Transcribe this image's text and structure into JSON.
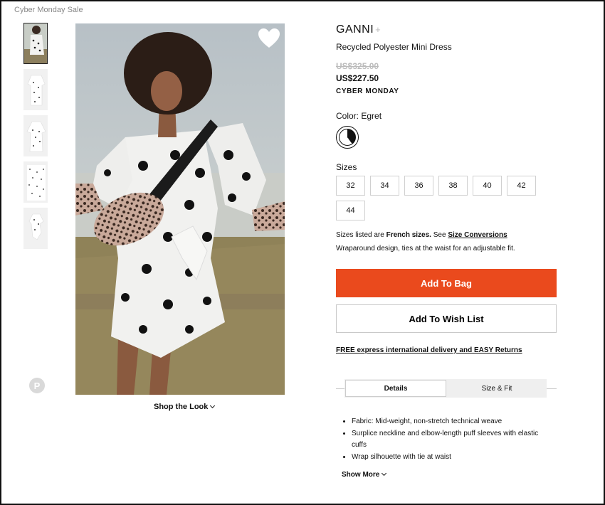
{
  "breadcrumb": "Cyber Monday Sale",
  "thumbnails": [
    "thumb-1",
    "thumb-2",
    "thumb-3",
    "thumb-4",
    "thumb-5"
  ],
  "pinterest_glyph": "P",
  "shop_the_look": "Shop the Look",
  "product": {
    "brand": "GANNI",
    "brand_plus": "+",
    "name": "Recycled Polyester Mini Dress",
    "old_price": "US$325.00",
    "new_price": "US$227.50",
    "promo": "CYBER MONDAY",
    "color_label": "Color: Egret",
    "sizes_label": "Sizes",
    "sizes": [
      "32",
      "34",
      "36",
      "38",
      "40",
      "42",
      "44"
    ],
    "size_note_prefix": "Sizes listed are ",
    "size_note_bold": "French sizes.",
    "size_note_mid": " See ",
    "size_note_link": "Size Conversions",
    "description": "Wraparound design, ties at the waist for an adjustable fit.",
    "add_to_bag": "Add To Bag",
    "add_to_wishlist": "Add To Wish List",
    "delivery": "FREE express international delivery and EASY Returns"
  },
  "tabs": [
    {
      "label": "Details",
      "active": true
    },
    {
      "label": "Size & Fit",
      "active": false
    }
  ],
  "details": [
    "Fabric: Mid-weight, non-stretch technical weave",
    "Surplice neckline and elbow-length puff sleeves with elastic cuffs",
    "Wrap silhouette with tie at waist"
  ],
  "show_more": "Show More",
  "colors": {
    "accent": "#ea4a1d",
    "text": "#111111",
    "muted": "#888888"
  }
}
